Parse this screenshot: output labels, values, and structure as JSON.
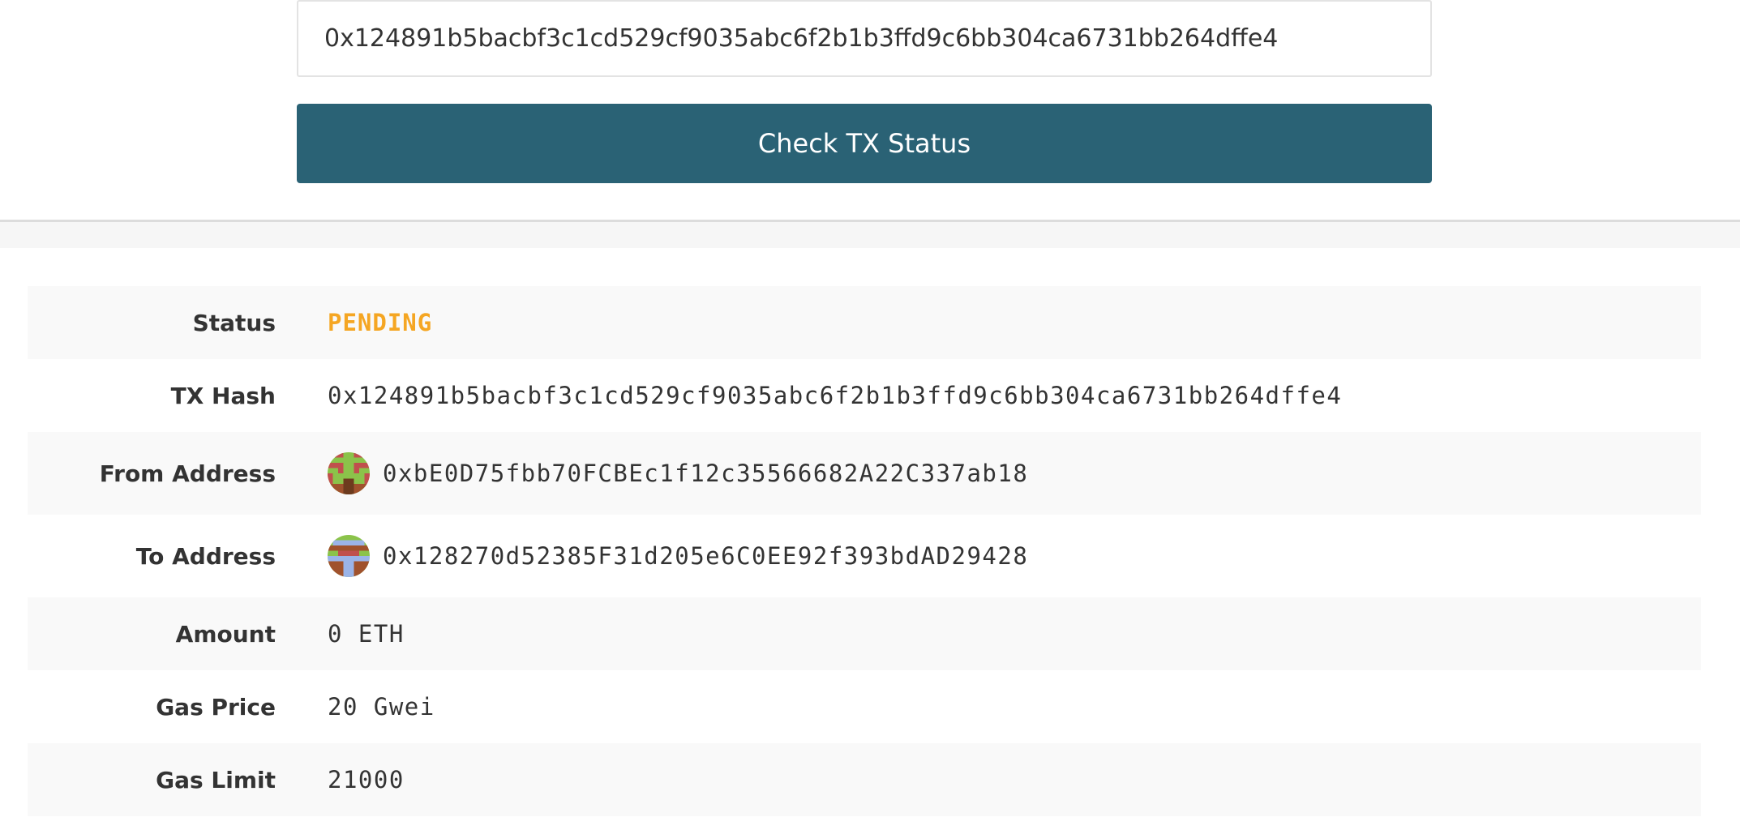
{
  "search": {
    "value": "0x124891b5bacbf3c1cd529cf9035abc6f2b1b3ffd9c6bb304ca6731bb264dffe4"
  },
  "check_button": {
    "label": "Check TX Status"
  },
  "colors": {
    "button": "#2a6275",
    "status_pending": "#f5a623"
  },
  "details": {
    "status": {
      "label": "Status",
      "value": "PENDING"
    },
    "tx_hash": {
      "label": "TX Hash",
      "value": "0x124891b5bacbf3c1cd529cf9035abc6f2b1b3ffd9c6bb304ca6731bb264dffe4"
    },
    "from": {
      "label": "From Address",
      "value": "0xbE0D75fbb70FCBEc1f12c35566682A22C337ab18",
      "icon": "identicon"
    },
    "to": {
      "label": "To Address",
      "value": "0x128270d52385F31d205e6C0EE92f393bdAD29428",
      "icon": "identicon"
    },
    "amount": {
      "label": "Amount",
      "value": "0 ETH"
    },
    "gas_price": {
      "label": "Gas Price",
      "value": "20 Gwei"
    },
    "gas_limit": {
      "label": "Gas Limit",
      "value": "21000"
    }
  }
}
